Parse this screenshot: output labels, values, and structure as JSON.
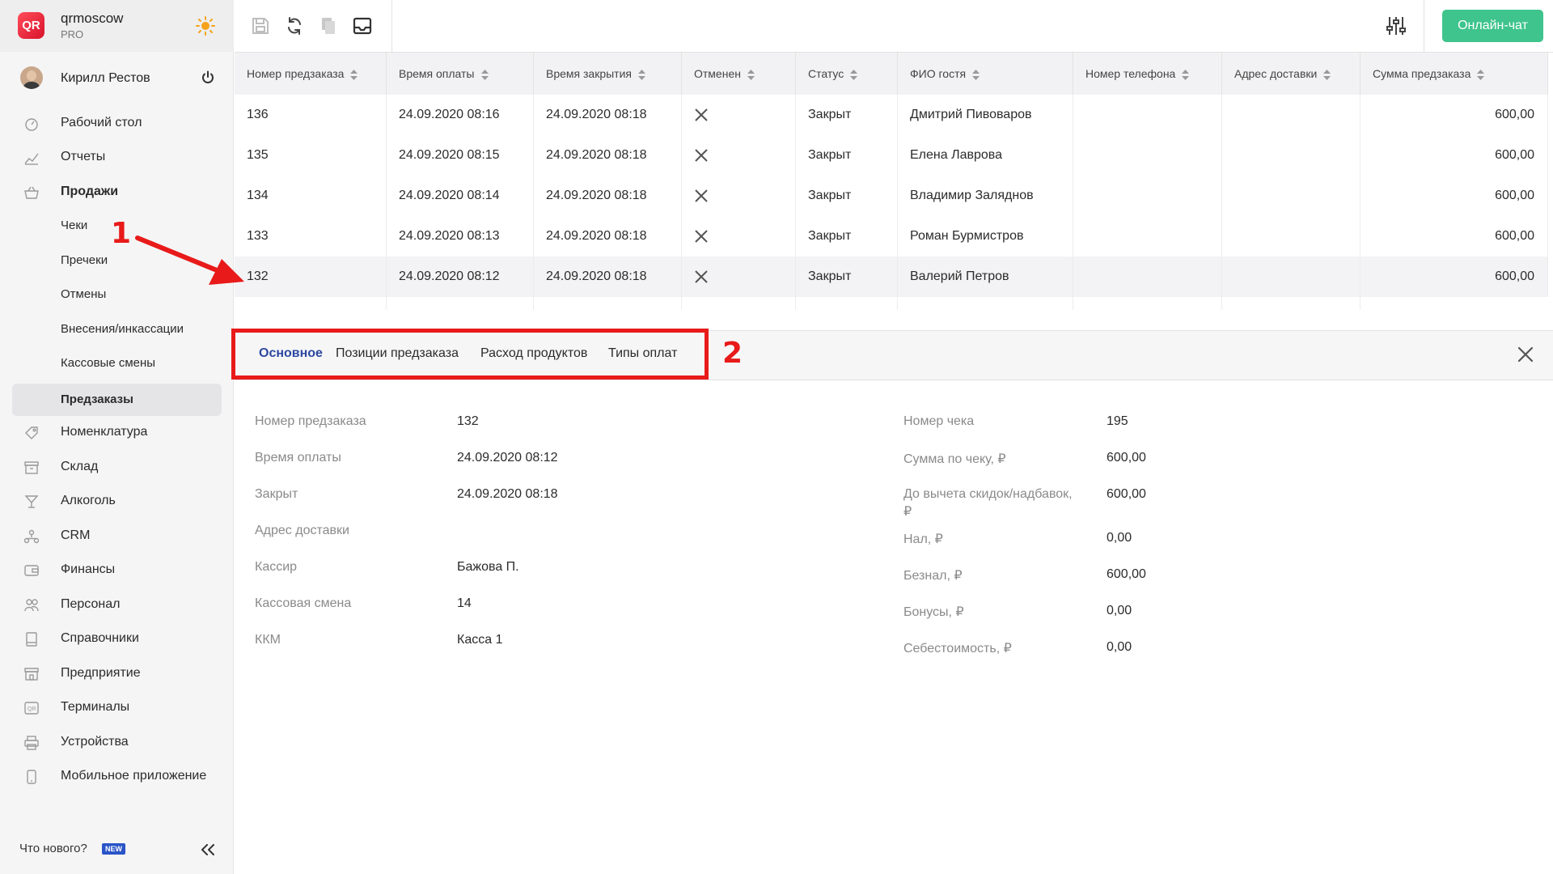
{
  "brand": {
    "logo": "QR",
    "name": "qrmoscow",
    "plan": "PRO"
  },
  "user": {
    "name": "Кирилл Рестов"
  },
  "nav": {
    "items": [
      {
        "label": "Рабочий стол",
        "icon": "dashboard-icon"
      },
      {
        "label": "Отчеты",
        "icon": "chart-icon"
      },
      {
        "label": "Продажи",
        "icon": "basket-icon"
      },
      {
        "label": "Номенклатура",
        "icon": "tag-icon"
      },
      {
        "label": "Склад",
        "icon": "archive-icon"
      },
      {
        "label": "Алкоголь",
        "icon": "glass-icon"
      },
      {
        "label": "CRM",
        "icon": "crm-icon"
      },
      {
        "label": "Финансы",
        "icon": "wallet-icon"
      },
      {
        "label": "Персонал",
        "icon": "people-icon"
      },
      {
        "label": "Справочники",
        "icon": "book-icon"
      },
      {
        "label": "Предприятие",
        "icon": "store-icon"
      },
      {
        "label": "Терминалы",
        "icon": "terminal-icon"
      },
      {
        "label": "Устройства",
        "icon": "printer-icon"
      },
      {
        "label": "Мобильное приложение",
        "icon": "phone-icon"
      }
    ],
    "sales_sub": [
      "Чеки",
      "Пречеки",
      "Отмены",
      "Внесения/инкассации",
      "Кассовые смены",
      "Предзаказы"
    ]
  },
  "footer": {
    "whats_new": "Что нового?",
    "badge": "NEW"
  },
  "toolbar": {
    "chat": "Онлайн-чат"
  },
  "table": {
    "columns": [
      "Номер предзаказа",
      "Время оплаты",
      "Время закрытия",
      "Отменен",
      "Статус",
      "ФИО гостя",
      "Номер телефона",
      "Адрес доставки",
      "Сумма предзаказа"
    ],
    "rows": [
      {
        "id": "136",
        "paid": "24.09.2020 08:16",
        "closed": "24.09.2020 08:18",
        "status": "Закрыт",
        "guest": "Дмитрий Пивоваров",
        "phone": "",
        "address": "",
        "sum": "600,00"
      },
      {
        "id": "135",
        "paid": "24.09.2020 08:15",
        "closed": "24.09.2020 08:18",
        "status": "Закрыт",
        "guest": "Елена Лаврова",
        "phone": "",
        "address": "",
        "sum": "600,00"
      },
      {
        "id": "134",
        "paid": "24.09.2020 08:14",
        "closed": "24.09.2020 08:18",
        "status": "Закрыт",
        "guest": "Владимир Заляднов",
        "phone": "",
        "address": "",
        "sum": "600,00"
      },
      {
        "id": "133",
        "paid": "24.09.2020 08:13",
        "closed": "24.09.2020 08:18",
        "status": "Закрыт",
        "guest": "Роман Бурмистров",
        "phone": "",
        "address": "",
        "sum": "600,00"
      },
      {
        "id": "132",
        "paid": "24.09.2020 08:12",
        "closed": "24.09.2020 08:18",
        "status": "Закрыт",
        "guest": "Валерий Петров",
        "phone": "",
        "address": "",
        "sum": "600,00"
      }
    ]
  },
  "tabs": [
    "Основное",
    "Позиции предзаказа",
    "Расход продуктов",
    "Типы оплат"
  ],
  "annotations": {
    "one": "1",
    "two": "2",
    "color": "#e81a1a"
  },
  "details": {
    "left": [
      {
        "label": "Номер предзаказа",
        "value": "132"
      },
      {
        "label": "Время оплаты",
        "value": "24.09.2020 08:12"
      },
      {
        "label": "Закрыт",
        "value": "24.09.2020 08:18"
      },
      {
        "label": "Адрес доставки",
        "value": ""
      },
      {
        "label": "Кассир",
        "value": "Бажова П."
      },
      {
        "label": "Кассовая смена",
        "value": "14"
      },
      {
        "label": "ККМ",
        "value": "Касса 1"
      }
    ],
    "right": [
      {
        "label": "Номер чека",
        "value": "195"
      },
      {
        "label": "Сумма по чеку, ₽",
        "value": "600,00"
      },
      {
        "label": "До вычета скидок/надбавок,",
        "label2": "₽",
        "value": "600,00"
      },
      {
        "label": "Нал, ₽",
        "value": "0,00"
      },
      {
        "label": "Безнал, ₽",
        "value": "600,00"
      },
      {
        "label": "Бонусы, ₽",
        "value": "0,00"
      },
      {
        "label": "Себестоимость, ₽",
        "value": "0,00"
      }
    ]
  },
  "colors": {
    "accent": "#2d48a0",
    "chat": "#3ec48c",
    "annotation": "#e81a1a"
  }
}
